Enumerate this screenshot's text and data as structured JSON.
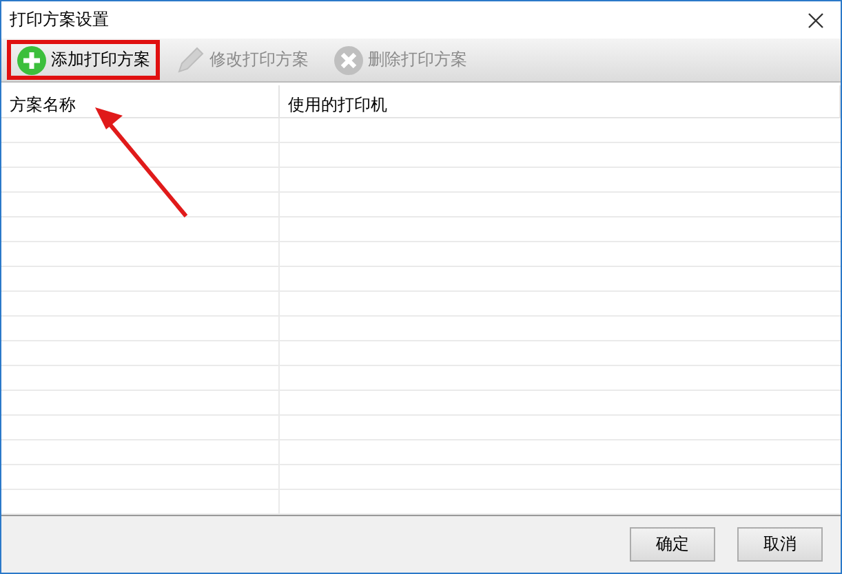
{
  "window": {
    "title": "打印方案设置"
  },
  "toolbar": [
    {
      "kind": "add",
      "label": "添加打印方案",
      "disabled": false,
      "highlighted": true
    },
    {
      "kind": "edit",
      "label": "修改打印方案",
      "disabled": true,
      "highlighted": false
    },
    {
      "kind": "delete",
      "label": "删除打印方案",
      "disabled": true,
      "highlighted": false
    }
  ],
  "table": {
    "columns": [
      "方案名称",
      "使用的打印机"
    ]
  },
  "buttons": [
    "确定",
    "取消"
  ]
}
